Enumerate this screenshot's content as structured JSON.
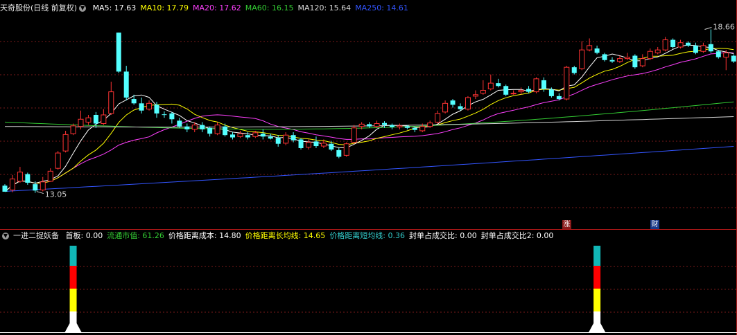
{
  "header": {
    "title": "天奇股份(日线 前复权)",
    "ma_values": [
      {
        "label": "MA5: 17.63",
        "color": "#ffffff"
      },
      {
        "label": "MA10: 17.79",
        "color": "#ffff00"
      },
      {
        "label": "MA20: 17.62",
        "color": "#ff40ff"
      },
      {
        "label": "MA60: 16.15",
        "color": "#33cc33"
      },
      {
        "label": "MA120: 15.64",
        "color": "#d8d8d8"
      },
      {
        "label": "MA250: 14.61",
        "color": "#3355ff"
      }
    ]
  },
  "indicator_header": {
    "name": "一进二捉妖备",
    "items": [
      {
        "label": "首板: 0.00",
        "color": "#ffffff"
      },
      {
        "label": "流通市值: 61.26",
        "color": "#33cc33"
      },
      {
        "label": "价格距离成本: 14.80",
        "color": "#ffffff"
      },
      {
        "label": "价格距离长均线: 14.65",
        "color": "#ffff00"
      },
      {
        "label": "价格距离短均线: 0.36",
        "color": "#33cccc"
      },
      {
        "label": "封单占成交比: 0.00",
        "color": "#ffffff"
      },
      {
        "label": "封单占成交比2: 0.00",
        "color": "#ffffff"
      }
    ]
  },
  "annotations": {
    "high_label": "18.66",
    "low_label": "13.05"
  },
  "badges": {
    "zhang": "涨",
    "cai": "财"
  },
  "colors": {
    "up": "#ff3333",
    "down": "#54ffff",
    "ma5": "#ffffff",
    "ma10": "#ffff00",
    "ma20": "#ff40ff",
    "ma60": "#33cc33",
    "ma120": "#d8d8d8",
    "ma250": "#3355ff",
    "grid": "#7a1a1a"
  },
  "chart_data": [
    {
      "type": "candlestick",
      "title": "天奇股份(日线 前复权)",
      "ylim": [
        12.2,
        19.2
      ],
      "candles": [
        [
          13.25,
          13.04,
          13.05,
          13.3
        ],
        [
          13.1,
          13.48,
          13.02,
          13.62
        ],
        [
          13.4,
          13.72,
          13.35,
          13.9
        ],
        [
          13.65,
          13.35,
          13.28,
          13.7
        ],
        [
          13.3,
          13.08,
          13.0,
          13.4
        ],
        [
          13.1,
          13.38,
          13.05,
          13.55
        ],
        [
          13.4,
          13.75,
          13.38,
          13.85
        ],
        [
          13.85,
          14.38,
          13.8,
          14.45
        ],
        [
          14.45,
          15.02,
          14.4,
          15.15
        ],
        [
          15.05,
          15.32,
          15.0,
          15.4
        ],
        [
          15.3,
          15.55,
          15.2,
          15.85
        ],
        [
          15.45,
          15.6,
          15.35,
          15.7
        ],
        [
          15.7,
          15.4,
          15.25,
          15.8
        ],
        [
          15.4,
          15.7,
          15.35,
          15.9
        ],
        [
          15.75,
          16.5,
          15.7,
          16.85
        ],
        [
          18.55,
          17.2,
          17.15,
          18.55
        ],
        [
          17.2,
          16.3,
          16.2,
          17.4
        ],
        [
          16.25,
          16.1,
          16.05,
          16.4
        ],
        [
          16.1,
          15.85,
          15.75,
          16.3
        ],
        [
          15.9,
          16.1,
          15.85,
          16.2
        ],
        [
          16.05,
          15.75,
          15.6,
          16.15
        ],
        [
          15.72,
          15.7,
          15.6,
          15.82
        ],
        [
          15.75,
          15.55,
          15.4,
          15.8
        ],
        [
          15.5,
          15.3,
          15.25,
          15.6
        ],
        [
          15.3,
          15.2,
          15.1,
          15.4
        ],
        [
          15.2,
          15.35,
          15.1,
          15.45
        ],
        [
          15.35,
          15.2,
          15.1,
          15.45
        ],
        [
          15.25,
          15.05,
          14.95,
          15.3
        ],
        [
          15.05,
          15.35,
          15.0,
          15.45
        ],
        [
          15.3,
          15.0,
          14.95,
          15.4
        ],
        [
          15.02,
          14.92,
          14.85,
          15.1
        ],
        [
          14.95,
          15.05,
          14.9,
          15.15
        ],
        [
          15.0,
          14.92,
          14.85,
          15.1
        ],
        [
          14.95,
          15.08,
          14.9,
          15.15
        ],
        [
          15.05,
          14.95,
          14.85,
          15.2
        ],
        [
          14.95,
          14.88,
          14.85,
          15.05
        ],
        [
          14.9,
          14.7,
          14.6,
          15.0
        ],
        [
          14.72,
          15.0,
          14.65,
          15.1
        ],
        [
          15.0,
          14.82,
          14.75,
          15.1
        ],
        [
          14.85,
          14.55,
          14.5,
          14.9
        ],
        [
          14.58,
          14.75,
          14.5,
          14.85
        ],
        [
          14.78,
          14.62,
          14.55,
          14.95
        ],
        [
          14.62,
          14.72,
          14.55,
          14.85
        ],
        [
          14.7,
          14.5,
          14.45,
          14.8
        ],
        [
          14.48,
          14.25,
          14.2,
          14.55
        ],
        [
          14.3,
          14.7,
          14.25,
          14.75
        ],
        [
          14.75,
          15.25,
          14.7,
          15.35
        ],
        [
          15.3,
          15.38,
          15.2,
          15.45
        ],
        [
          15.38,
          15.3,
          15.25,
          15.45
        ],
        [
          15.3,
          15.4,
          15.25,
          15.5
        ],
        [
          15.42,
          15.35,
          15.25,
          15.48
        ],
        [
          15.35,
          15.28,
          15.2,
          15.4
        ],
        [
          15.28,
          15.32,
          15.2,
          15.4
        ],
        [
          15.3,
          15.25,
          15.2,
          15.35
        ],
        [
          15.25,
          15.18,
          15.1,
          15.3
        ],
        [
          15.15,
          15.3,
          15.1,
          15.4
        ],
        [
          15.3,
          15.42,
          15.25,
          15.5
        ],
        [
          15.45,
          15.75,
          15.4,
          15.85
        ],
        [
          15.8,
          16.1,
          15.75,
          16.2
        ],
        [
          16.2,
          16.05,
          15.95,
          16.25
        ],
        [
          16.0,
          15.9,
          15.85,
          16.1
        ],
        [
          15.9,
          16.3,
          15.85,
          16.35
        ],
        [
          16.35,
          16.4,
          16.25,
          16.55
        ],
        [
          16.45,
          16.55,
          16.4,
          16.9
        ],
        [
          16.6,
          16.8,
          16.55,
          17.1
        ],
        [
          16.8,
          16.7,
          16.65,
          16.95
        ],
        [
          16.7,
          16.4,
          16.35,
          16.75
        ],
        [
          16.45,
          16.45,
          16.4,
          16.55
        ],
        [
          16.5,
          16.55,
          16.4,
          16.65
        ],
        [
          16.6,
          16.5,
          16.45,
          16.7
        ],
        [
          16.5,
          16.95,
          16.45,
          17.0
        ],
        [
          16.9,
          16.6,
          16.5,
          17.0
        ],
        [
          16.58,
          16.35,
          16.3,
          16.65
        ],
        [
          16.35,
          16.25,
          16.2,
          16.45
        ],
        [
          16.25,
          17.35,
          16.2,
          17.4
        ],
        [
          17.35,
          17.15,
          17.1,
          17.4
        ],
        [
          17.3,
          17.95,
          17.25,
          18.25
        ],
        [
          17.95,
          18.1,
          17.9,
          18.35
        ],
        [
          18.0,
          17.85,
          17.8,
          18.1
        ],
        [
          17.8,
          17.6,
          17.55,
          17.85
        ],
        [
          17.6,
          17.55,
          17.5,
          17.7
        ],
        [
          17.55,
          17.65,
          17.5,
          17.75
        ],
        [
          17.65,
          17.7,
          17.6,
          17.85
        ],
        [
          17.75,
          17.35,
          17.3,
          17.8
        ],
        [
          17.4,
          17.65,
          17.35,
          17.8
        ],
        [
          17.65,
          17.9,
          17.6,
          18.0
        ],
        [
          17.85,
          17.95,
          17.8,
          18.05
        ],
        [
          17.95,
          18.3,
          17.9,
          18.4
        ],
        [
          18.3,
          18.05,
          18.0,
          18.35
        ],
        [
          18.05,
          18.2,
          18.0,
          18.3
        ],
        [
          18.2,
          18.1,
          18.05,
          18.25
        ],
        [
          18.1,
          17.85,
          17.8,
          18.2
        ],
        [
          17.9,
          18.1,
          17.85,
          18.2
        ],
        [
          18.15,
          17.9,
          17.85,
          18.66
        ],
        [
          17.9,
          17.7,
          17.65,
          17.95
        ],
        [
          17.7,
          17.85,
          17.25,
          17.95
        ],
        [
          17.75,
          17.55,
          17.5,
          17.8
        ]
      ]
    },
    {
      "type": "bar",
      "title": "一进二捉妖备",
      "signals": [
        {
          "index": 9,
          "value": 1
        },
        {
          "index": 78,
          "value": 1
        }
      ]
    }
  ]
}
